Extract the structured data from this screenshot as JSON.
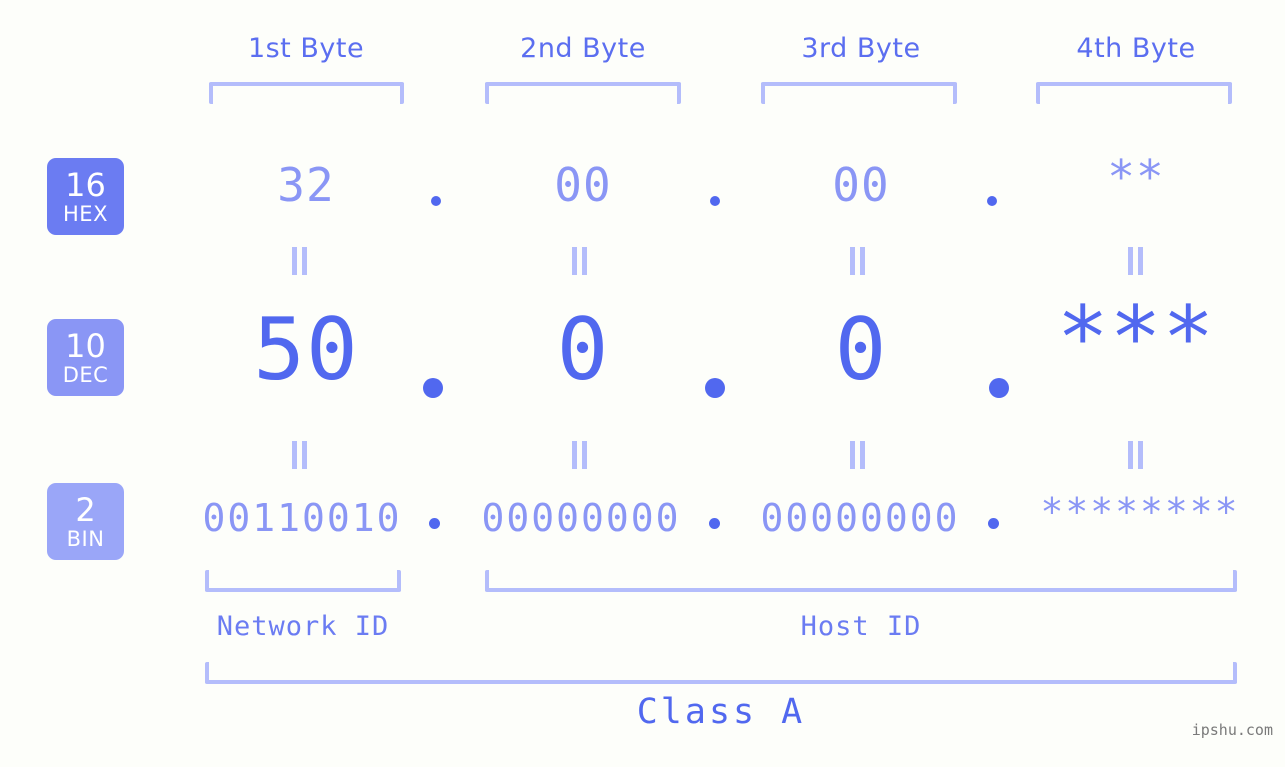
{
  "meta": {
    "background_color": "#fdfefa",
    "accent_strong": "#5168ef",
    "accent_mid": "#8a96f5",
    "accent_light": "#b4bdfb",
    "watermark": "ipshu.com"
  },
  "byte_headers": [
    {
      "label": "1st Byte"
    },
    {
      "label": "2nd Byte"
    },
    {
      "label": "3rd Byte"
    },
    {
      "label": "4th Byte"
    }
  ],
  "bases": [
    {
      "number": "16",
      "name": "HEX",
      "color": "#6b7cf2"
    },
    {
      "number": "10",
      "name": "DEC",
      "color": "#8a96f5"
    },
    {
      "number": "2",
      "name": "BIN",
      "color": "#9aa6f8"
    }
  ],
  "rows": {
    "hex": {
      "base_number": "16",
      "base_name": "HEX",
      "values": [
        "32",
        "00",
        "00",
        "**"
      ],
      "separator": "."
    },
    "dec": {
      "base_number": "10",
      "base_name": "DEC",
      "values": [
        "50",
        "0",
        "0",
        "***"
      ],
      "separator": "."
    },
    "bin": {
      "base_number": "2",
      "base_name": "BIN",
      "values": [
        "00110010",
        "00000000",
        "00000000",
        "********"
      ],
      "separator": "."
    }
  },
  "equals_marks": {
    "glyph": "=",
    "count_per_row_gap": 4
  },
  "segments": {
    "network_id": {
      "label": "Network ID"
    },
    "host_id": {
      "label": "Host ID"
    },
    "class": {
      "label": "Class A"
    }
  },
  "dotted_address": {
    "hex": "32.00.00.**",
    "dec": "50.0.0.***",
    "bin": "00110010.00000000.00000000.********"
  }
}
